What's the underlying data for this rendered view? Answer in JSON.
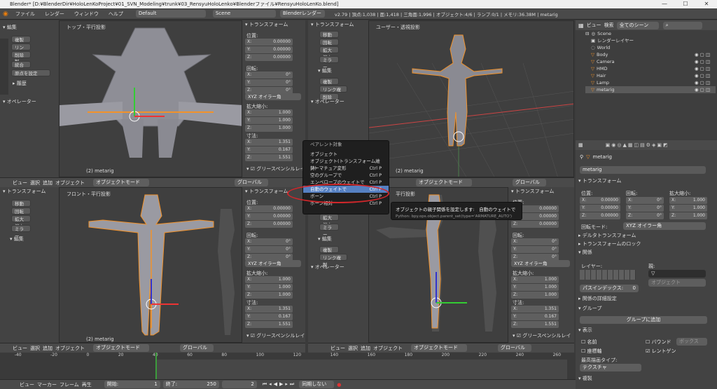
{
  "window": {
    "title": "Blender* [D:¥BlenderDir¥HoloLenKoProject¥01_SVN_Modeling¥trunk¥03_RensyuHoloLenko¥Blenderファイル¥RensyuHoloLenKo.blend]",
    "min": "—",
    "max": "☐",
    "close": "✕"
  },
  "topbar": {
    "menus": [
      "ファイル",
      "レンダー",
      "ウィンドウ",
      "ヘルプ"
    ],
    "layout": "Default",
    "scene": "Scene",
    "engine": "Blenderレンダー",
    "stats": "v2.79 | 頂点:1,038 | 面:1,418 | 三角面:1,996 | オブジェクト:4/6 | ランプ:0/1 | メモリ:36.38M | metarig"
  },
  "toolshelf": {
    "edit_header": "編集",
    "dup": "複製",
    "link_dup": "リンク複製",
    "delete": "削除",
    "join": "統合",
    "origin": "原点を設定",
    "history": "履歴",
    "operator": "オペレーター",
    "transform_header": "トランスフォーム",
    "move": "移動",
    "rotate": "回転",
    "scale": "拡大縮小",
    "mirror": "ミラー"
  },
  "npanel": {
    "header": "トランスフォーム",
    "location": "位置:",
    "rotation": "回転:",
    "scale": "拡大縮小:",
    "dimensions": "寸法:",
    "euler": "XYZ オイラー角",
    "grease": "グリースペンシルレイ",
    "x": "X:",
    "y": "Y:",
    "z": "Z:",
    "loc_vals": [
      "0.00000",
      "0.00000",
      "0.00000"
    ],
    "rot_vals": [
      "0°",
      "0°",
      "0°"
    ],
    "scale_vals": [
      "1.000",
      "1.000",
      "1.000"
    ],
    "dim_vals": [
      "1.351",
      "0.167",
      "1.551"
    ]
  },
  "viewports": {
    "tl_label": "トップ・平行投影",
    "tr_label": "ユーザー・透視投影",
    "bl_label": "フロント・平行投影",
    "br_label": "平行投影",
    "obj": "(2) metarig"
  },
  "footer": {
    "view": "ビュー",
    "select": "選択",
    "add": "追加",
    "object": "オブジェクト",
    "mode": "オブジェクトモード",
    "global": "グローバル"
  },
  "context_menu": {
    "title": "ペアレント対象",
    "items": [
      {
        "label": "オブジェクト",
        "key": ""
      },
      {
        "label": "オブジェクト(トランスフォーム維持)",
        "key": ""
      },
      {
        "label": "アーマチュア変形",
        "key": "Ctrl P"
      },
      {
        "label": "空のグループで",
        "key": "Ctrl P"
      },
      {
        "label": "エンベロープのウェイトで",
        "key": "Ctrl P"
      },
      {
        "label": "自動のウェイトで",
        "key": "Ctrl P"
      },
      {
        "label": "ボーン",
        "key": "Ctrl P"
      },
      {
        "label": "ボーン相対",
        "key": "Ctrl P"
      }
    ]
  },
  "tooltip": {
    "line1": "オブジェクトの親子関係を設定します:　自動のウェイトで",
    "line2": "Python: bpy.ops.object.parent_set(type='ARMATURE_AUTO')"
  },
  "outliner": {
    "view": "ビュー",
    "search": "検索",
    "filter": "全てのシーン",
    "rows": [
      "Scene",
      "レンダーレイヤー",
      "World",
      "Body",
      "Camera",
      "HMD",
      "Hair",
      "Lamp",
      "metarig"
    ]
  },
  "props": {
    "breadcrumb": "metarig",
    "name": "metarig",
    "transform": "トランスフォーム",
    "location": "位置:",
    "rotation": "回転:",
    "scale": "拡大縮小:",
    "x": "X:",
    "y": "Y:",
    "z": "Z:",
    "loc_vals": [
      "0.00000",
      "0.00000",
      "0.00000"
    ],
    "rot_vals": [
      "0°",
      "0°",
      "0°"
    ],
    "scale_vals": [
      "1.000",
      "1.000",
      "1.000"
    ],
    "rot_mode_label": "回転モード:",
    "rot_mode": "XYZ オイラー角",
    "delta": "デルタトランスフォーム",
    "lock": "トランスフォームのロック",
    "relations": "関係",
    "layers": "レイヤー:",
    "parent": "親:",
    "parent_type": "オブジェクト",
    "pass_index": "パスインデックス:",
    "pass_val": "0",
    "relations_extra": "関係の詳細設定",
    "groups": "グループ",
    "add_group": "グループに追加",
    "display": "表示",
    "name_cb": "名前",
    "bounds_cb": "バウンド",
    "bounds_type": "ボックス",
    "axis_cb": "座標軸",
    "xray_cb": "レントゲン",
    "max_draw": "最高描画タイプ:",
    "texture": "テクスチャ",
    "dup": "複製"
  },
  "timeline": {
    "ticks": [
      "-40",
      "-20",
      "0",
      "20",
      "40",
      "60",
      "80",
      "100",
      "120",
      "140",
      "160",
      "180",
      "200",
      "220",
      "240",
      "260"
    ],
    "view": "ビュー",
    "marker": "マーカー",
    "frame": "フレーム",
    "play": "再生",
    "start_label": "開始:",
    "start": "1",
    "end_label": "終了:",
    "end": "250",
    "current": "2",
    "sync": "同期しない"
  }
}
